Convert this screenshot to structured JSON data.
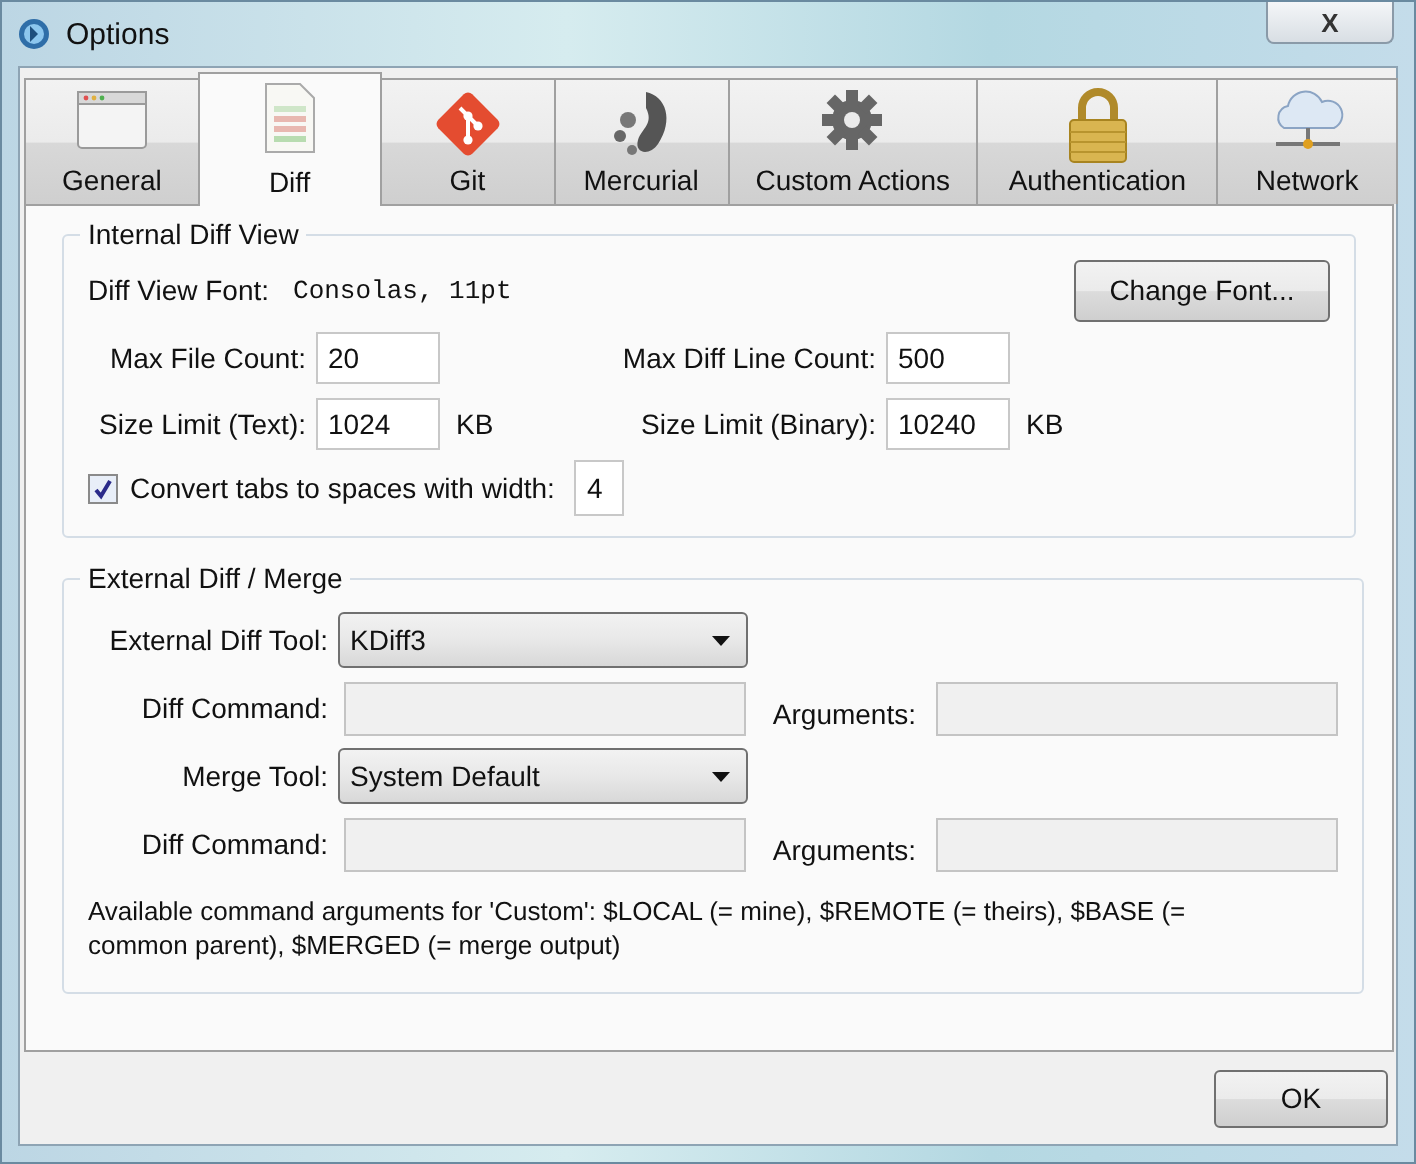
{
  "window": {
    "title": "Options",
    "close": "X"
  },
  "tabs": [
    {
      "label": "General",
      "selected": false
    },
    {
      "label": "Diff",
      "selected": true
    },
    {
      "label": "Git",
      "selected": false
    },
    {
      "label": "Mercurial",
      "selected": false
    },
    {
      "label": "Custom Actions",
      "selected": false
    },
    {
      "label": "Authentication",
      "selected": false
    },
    {
      "label": "Network",
      "selected": false
    }
  ],
  "internal": {
    "title": "Internal Diff View",
    "font_label": "Diff View Font:",
    "font_value": "Consolas, 11pt",
    "change_font": "Change Font...",
    "rows": [
      [
        {
          "label": "Max File Count:",
          "value": "20"
        },
        {
          "label": "Max Diff Line Count:",
          "value": "500"
        }
      ],
      [
        {
          "label": "Size Limit (Text):",
          "value": "1024",
          "unit": "KB"
        },
        {
          "label": "Size Limit (Binary):",
          "value": "10240",
          "unit": "KB"
        }
      ]
    ],
    "convert": {
      "label": "Convert tabs to spaces with width:",
      "checked": true,
      "value": "4"
    }
  },
  "external": {
    "title": "External Diff / Merge",
    "tools": [
      {
        "label": "External Diff Tool:",
        "value": "KDiff3",
        "command_label": "Diff Command:",
        "arguments_label": "Arguments:",
        "disabled": true
      },
      {
        "label": "Merge Tool:",
        "value": "System Default",
        "command_label": "Diff Command:",
        "arguments_label": "Arguments:",
        "disabled": true
      }
    ],
    "note": "Available command arguments for 'Custom': $LOCAL (= mine), $REMOTE (= theirs), $BASE (= common parent), $MERGED (= merge output)"
  },
  "buttons": [
    "OK"
  ]
}
